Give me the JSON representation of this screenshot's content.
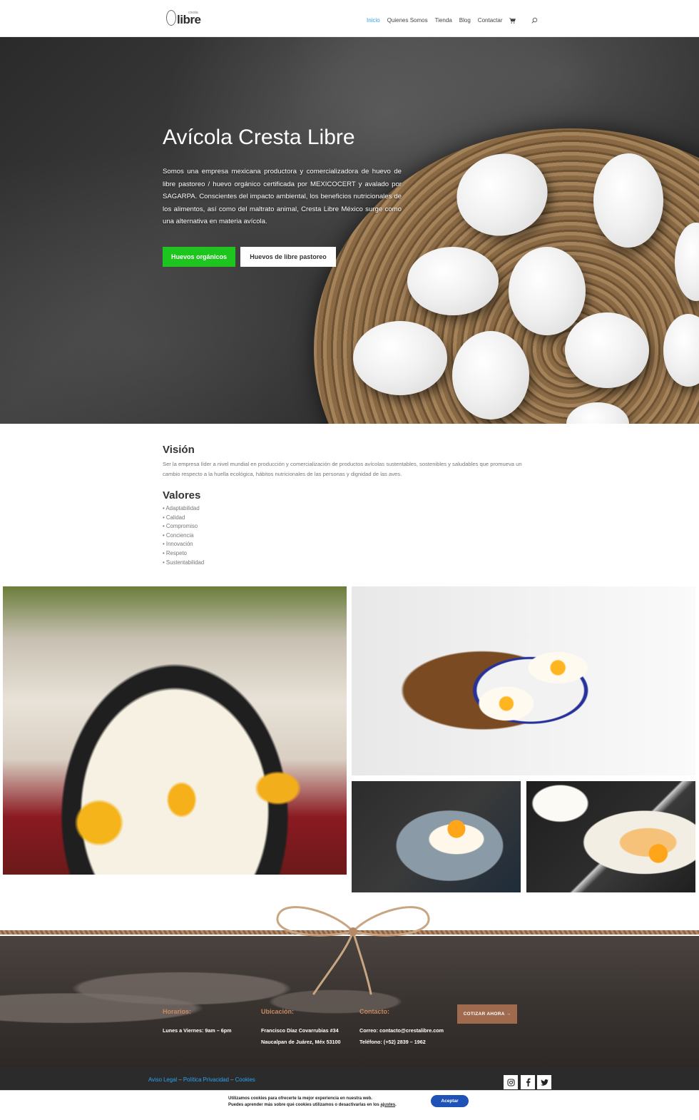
{
  "header": {
    "logo_text": "libre",
    "logo_small": "cresta",
    "nav": [
      "Inicio",
      "Quienes Somos",
      "Tienda",
      "Blog",
      "Contactar"
    ],
    "cart_icon": "cart-icon",
    "search_icon": "search-icon"
  },
  "hero": {
    "title": "Avícola Cresta Libre",
    "text": "Somos una empresa mexicana productora y comercializadora de huevo de libre pastoreo / huevo orgánico certificada por MEXICOCERT y avalado por SAGARPA. Conscientes del impacto ambiental, los beneficios nutricionales de los alimentos, así como del maltrato animal, Cresta Libre México surge como una alternativa en materia avícola.",
    "btn_primary": "Huevos orgánicos",
    "btn_secondary": "Huevos de libre pastoreo",
    "primary_color": "#1fc51f"
  },
  "vision": {
    "title": "Visión",
    "text": "Ser la empresa líder a nivel mundial en producción y comercialización de productos avícolas sustentables, sostenibles y saludables que promueva un cambio respecto a la huella ecológica, hábitos nutricionales de las personas y dignidad de las aves."
  },
  "values": {
    "title": "Valores",
    "items": [
      "Adaptabilidad",
      "Calidad",
      "Compromiso",
      "Conciencia",
      "Innovación",
      "Respeto",
      "Sustentabilidad"
    ]
  },
  "footer": {
    "horarios_title": "Horarios:",
    "horarios_text": "Lunes a Viernes: 9am – 6pm",
    "ubicacion_title": "Ubicación:",
    "ubicacion_line1": "Francisco Díaz Covarrubias #34",
    "ubicacion_line2": "Naucalpan de Juárez, Méx 53100",
    "contacto_title": "Contacto:",
    "contacto_line1": "Correo: contacto@crestalibre.com",
    "contacto_line2": "Teléfono: (+52) 2839 – 1962",
    "cta": "COTIZAR AHORA →",
    "accent_color": "#c98a60"
  },
  "bottom": {
    "legal_1": "Aviso Legal",
    "legal_2": "Política Privacidad",
    "legal_3": "Cookies",
    "sep": " – ",
    "social": [
      "instagram-icon",
      "facebook-icon",
      "twitter-icon"
    ]
  },
  "cookie": {
    "line1": "Utilizamos cookies para ofrecerte la mejor experiencia en nuestra web.",
    "line2": "Puedes aprender más sobre qué cookies utilizamos o desactivarlas en los",
    "link": "ajustes",
    "accept": "Aceptar"
  }
}
